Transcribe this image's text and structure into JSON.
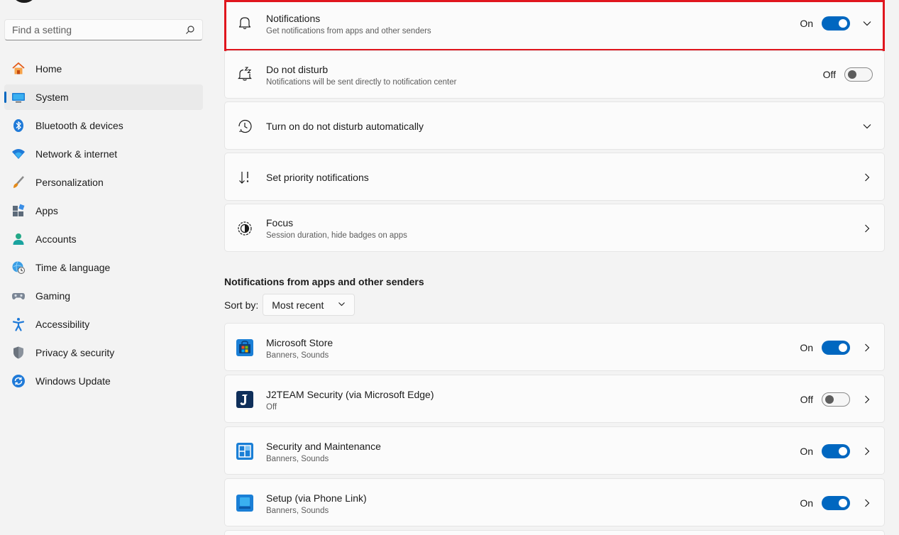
{
  "search": {
    "placeholder": "Find a setting",
    "icon": "search-icon"
  },
  "sidebar": {
    "items": [
      {
        "label": "Home",
        "icon": "home-icon"
      },
      {
        "label": "System",
        "icon": "system-icon",
        "active": true
      },
      {
        "label": "Bluetooth & devices",
        "icon": "bluetooth-icon"
      },
      {
        "label": "Network & internet",
        "icon": "wifi-icon"
      },
      {
        "label": "Personalization",
        "icon": "brush-icon"
      },
      {
        "label": "Apps",
        "icon": "apps-icon"
      },
      {
        "label": "Accounts",
        "icon": "accounts-icon"
      },
      {
        "label": "Time & language",
        "icon": "globe-clock-icon"
      },
      {
        "label": "Gaming",
        "icon": "gamepad-icon"
      },
      {
        "label": "Accessibility",
        "icon": "accessibility-icon"
      },
      {
        "label": "Privacy & security",
        "icon": "shield-icon"
      },
      {
        "label": "Windows Update",
        "icon": "update-icon"
      }
    ]
  },
  "settings": {
    "notifications": {
      "title": "Notifications",
      "subtitle": "Get notifications from apps and other senders",
      "state": "On",
      "icon": "bell-icon"
    },
    "dnd": {
      "title": "Do not disturb",
      "subtitle": "Notifications will be sent directly to notification center",
      "state": "Off",
      "icon": "bell-zz-icon"
    },
    "dnd_auto": {
      "title": "Turn on do not disturb automatically",
      "icon": "clock-icon"
    },
    "priority": {
      "title": "Set priority notifications",
      "icon": "priority-sort-icon"
    },
    "focus": {
      "title": "Focus",
      "subtitle": "Session duration, hide badges on apps",
      "icon": "focus-icon"
    }
  },
  "apps_section": {
    "title": "Notifications from apps and other senders",
    "sort_label": "Sort by:",
    "sort_value": "Most recent",
    "apps": [
      {
        "name": "Microsoft Store",
        "detail": "Banners, Sounds",
        "state": "On",
        "icon": "microsoft-store-icon"
      },
      {
        "name": "J2TEAM Security (via Microsoft Edge)",
        "detail": "Off",
        "state": "Off",
        "icon": "j2team-icon"
      },
      {
        "name": "Security and Maintenance",
        "detail": "Banners, Sounds",
        "state": "On",
        "icon": "security-maintenance-icon"
      },
      {
        "name": "Setup (via Phone Link)",
        "detail": "Banners, Sounds",
        "state": "On",
        "icon": "phone-link-icon"
      }
    ]
  },
  "colors": {
    "accent": "#0067c0",
    "highlight": "#e0161e",
    "background": "#f3f3f3",
    "card": "#fbfbfb"
  }
}
